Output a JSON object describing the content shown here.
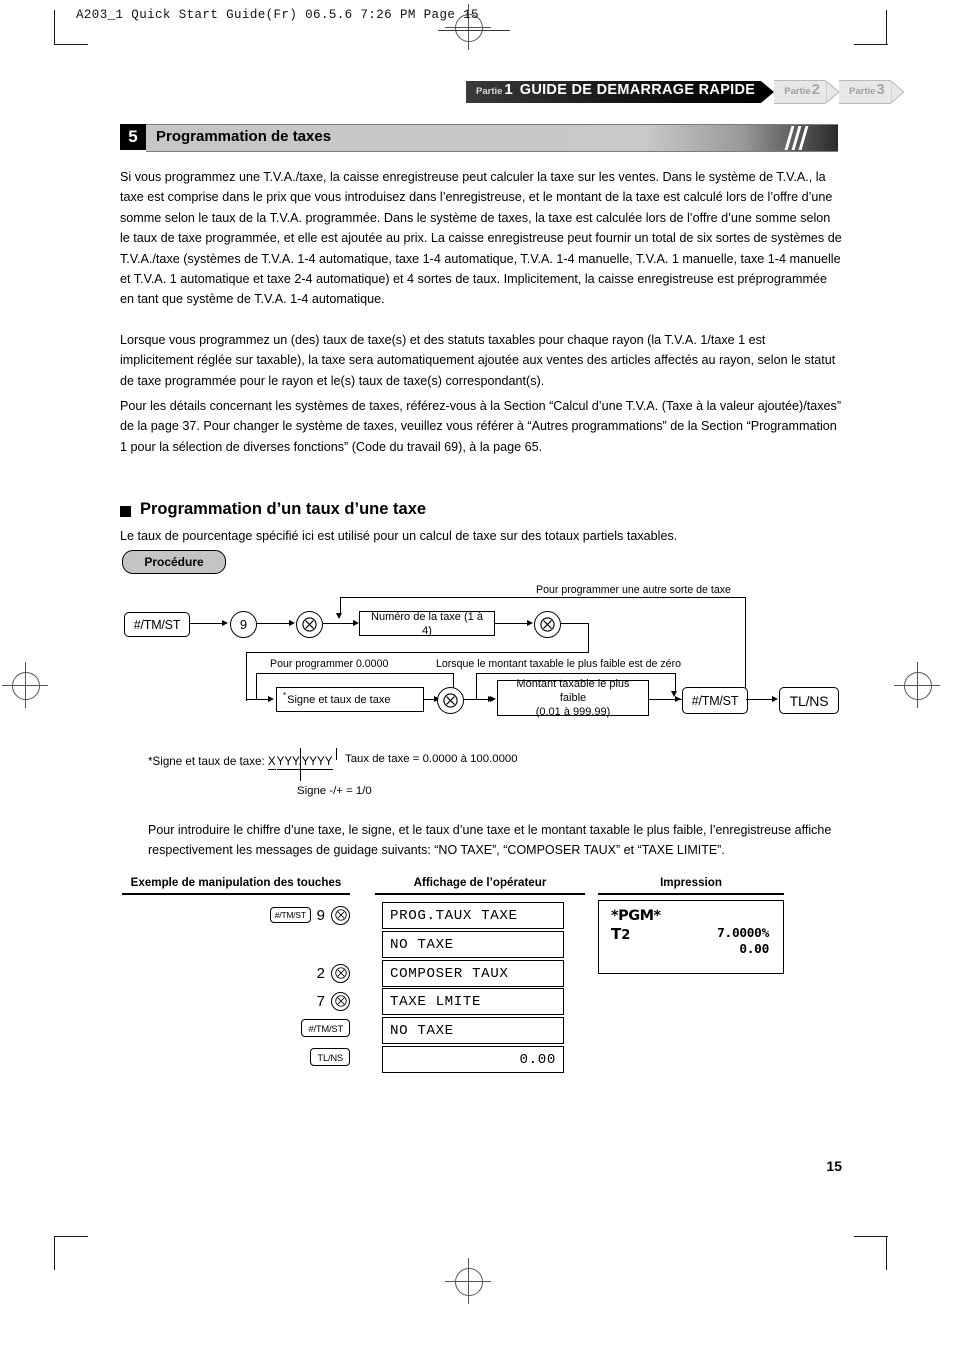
{
  "slug": "A203_1 Quick Start Guide(Fr)  06.5.6 7:26 PM  Page 15",
  "tabs": [
    {
      "label": "Partie",
      "num": "1",
      "title": "GUIDE DE DEMARRAGE RAPIDE",
      "active": true
    },
    {
      "label": "Partie",
      "num": "2",
      "title": "",
      "active": false
    },
    {
      "label": "Partie",
      "num": "3",
      "title": "",
      "active": false
    }
  ],
  "section": {
    "number": "5",
    "title": "Programmation de taxes"
  },
  "paragraphs": {
    "p1": "Si vous programmez une T.V.A./taxe, la caisse enregistreuse peut calculer la taxe sur les ventes. Dans le système de T.V.A., la taxe est comprise dans le prix que vous introduisez dans l’enregistreuse, et le montant de la taxe est calculé lors de l’offre d’une somme selon le taux de la T.V.A. programmée. Dans le système de taxes, la taxe est calculée lors de l’offre d’une somme selon le taux de taxe programmée, et elle est ajoutée au prix. La caisse enregistreuse peut fournir un total de six sortes de systèmes de T.V.A./taxe (systèmes de T.V.A. 1-4 automatique, taxe 1-4 automatique, T.V.A. 1-4 manuelle, T.V.A. 1 manuelle, taxe 1-4 manuelle et T.V.A. 1 automatique et taxe 2-4 automatique) et 4 sortes de taux. Implicitement, la caisse enregistreuse est préprogrammée en tant que système de T.V.A. 1-4 automatique.",
    "p2": "Lorsque vous programmez un (des) taux de taxe(s) et des statuts taxables pour chaque rayon (la T.V.A. 1/taxe 1 est implicitement réglée sur taxable), la taxe sera automatiquement ajoutée aux ventes des articles affectés au rayon, selon le statut de taxe programmée pour le rayon et le(s) taux de taxe(s) correspondant(s).",
    "p3": "Pour les détails concernant les systèmes de taxes, référez-vous à la Section “Calcul d’une T.V.A. (Taxe à la valeur ajoutée)/taxes” de la page 37. Pour changer le système de taxes, veuillez vous référer à “Autres programmations” de la Section “Programmation 1 pour la sélection de diverses fonctions” (Code du travail 69), à la page 65."
  },
  "subsection": {
    "heading": "Programmation d’un taux d’une taxe",
    "intro": "Le taux de pourcentage spécifié ici est utilisé pour un calcul de taxe sur des totaux partiels taxables.",
    "procedure_badge": "Procédure"
  },
  "flowchart": {
    "label_other_tax": "Pour programmer une autre sorte de taxe",
    "label_program_zero": "Pour programmer 0.0000",
    "label_min_taxable_zero": "Lorsque le montant taxable le plus faible est de zéro",
    "node_tmst_1": "#/TM/ST",
    "node_nine": "9",
    "node_multiply": "✕",
    "node_tax_number": "Numéro de la taxe (1 à 4)",
    "node_sign_rate": "Signe et taux de taxe",
    "node_sign_rate_star": "*",
    "node_min_taxable_l1": "Montant taxable le plus faible",
    "node_min_taxable_l2": "(0.01 à 999.99)",
    "node_tmst_2": "#/TM/ST",
    "node_tlns": "TL/NS"
  },
  "footnote": {
    "prefix": "*Signe et taux de taxe:",
    "x": "X",
    "yyyy": "YYY.YYYY",
    "rate_line": "Taux de taxe = 0.0000 à 100.0000",
    "sign_line": "Signe -/+ = 1/0"
  },
  "explain": "Pour introduire le chiffre d’une taxe, le signe, et le taux d’une taxe et le montant taxable le plus faible, l’enregistreuse affiche respectivement les messages de guidage suivants: “NO TAXE”, “COMPOSER TAUX” et “TAXE LIMITE”.",
  "example": {
    "headers": {
      "keys": "Exemple de manipulation des touches",
      "display": "Affichage de l’opérateur",
      "print": "Impression"
    },
    "key_rows": [
      {
        "keys": [
          "#/TM/ST",
          "9",
          "✕"
        ]
      },
      {
        "keys": [
          "2",
          "✕"
        ]
      },
      {
        "keys": [
          "7",
          "✕"
        ]
      },
      {
        "keys": [
          "#/TM/ST"
        ]
      },
      {
        "keys": [
          "TL/NS"
        ]
      }
    ],
    "displays": [
      {
        "text": "PROG.TAUX TAXE",
        "align": "left"
      },
      {
        "text": "NO TAXE",
        "align": "left"
      },
      {
        "text": "COMPOSER TAUX",
        "align": "left"
      },
      {
        "text": "TAXE LMITE",
        "align": "left"
      },
      {
        "text": "NO TAXE",
        "align": "left"
      },
      {
        "text": "0.00",
        "align": "right"
      }
    ],
    "receipt": {
      "pgm": "*PGM*",
      "t_label": "T",
      "t_num": "2",
      "rate": "7.0000%",
      "amount": "0.00"
    }
  },
  "page_number": "15"
}
